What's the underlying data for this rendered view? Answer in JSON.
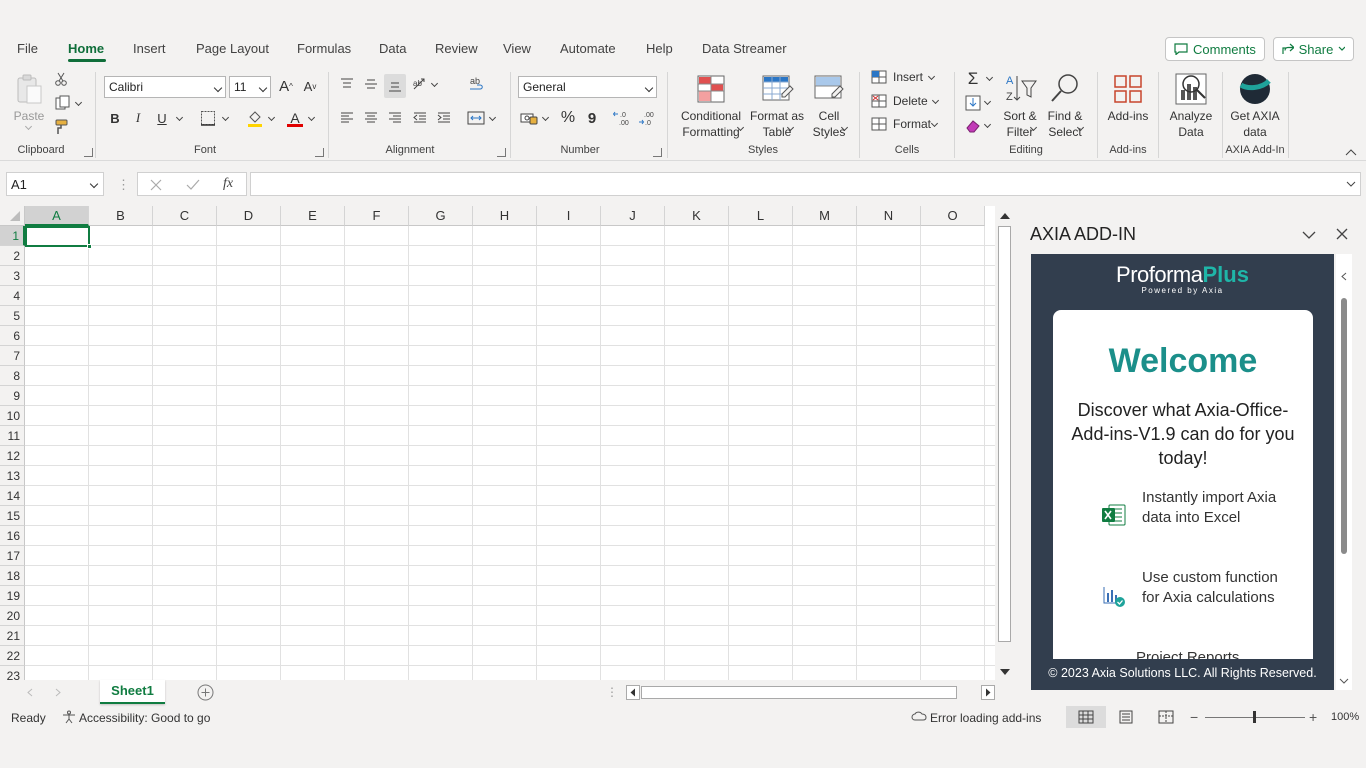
{
  "tabs": [
    "File",
    "Home",
    "Insert",
    "Page Layout",
    "Formulas",
    "Data",
    "Review",
    "View",
    "Automate",
    "Help",
    "Data Streamer"
  ],
  "header_buttons": {
    "comments": "Comments",
    "share": "Share"
  },
  "ribbon": {
    "clipboard": {
      "paste": "Paste",
      "label": "Clipboard"
    },
    "font": {
      "family": "Calibri",
      "size": "11",
      "bold": "B",
      "italic": "I",
      "underline": "U",
      "grow": "A",
      "shrink": "A",
      "color_letter": "A",
      "label": "Font"
    },
    "alignment": {
      "label": "Alignment"
    },
    "number": {
      "format": "General",
      "percent": "%",
      "comma": "9",
      "label": "Number"
    },
    "styles": {
      "conditional_1": "Conditional",
      "conditional_2": "Formatting",
      "format_table_1": "Format as",
      "format_table_2": "Table",
      "cell_styles_1": "Cell",
      "cell_styles_2": "Styles",
      "label": "Styles"
    },
    "cells": {
      "insert": "Insert",
      "delete": "Delete",
      "format": "Format",
      "label": "Cells"
    },
    "editing": {
      "sort_1": "Sort &",
      "sort_2": "Filter",
      "find_1": "Find &",
      "find_2": "Select",
      "label": "Editing"
    },
    "addins": {
      "addins": "Add-ins",
      "label": "Add-ins"
    },
    "analyze": {
      "line1": "Analyze",
      "line2": "Data"
    },
    "axia": {
      "line1": "Get AXIA",
      "line2": "data",
      "label": "AXIA Add-In"
    }
  },
  "formula_bar": {
    "name_box": "A1",
    "fx": "fx",
    "formula": ""
  },
  "grid": {
    "columns": [
      "A",
      "B",
      "C",
      "D",
      "E",
      "F",
      "G",
      "H",
      "I",
      "J",
      "K",
      "L",
      "M",
      "N",
      "O"
    ],
    "rows": [
      "1",
      "2",
      "3",
      "4",
      "5",
      "6",
      "7",
      "8",
      "9",
      "10",
      "11",
      "12",
      "13",
      "14",
      "15",
      "16",
      "17",
      "18",
      "19",
      "20",
      "21",
      "22",
      "23"
    ],
    "selected_cell": "A1"
  },
  "sheets": {
    "active": "Sheet1"
  },
  "status": {
    "ready": "Ready",
    "accessibility": "Accessibility: Good to go",
    "error": "Error loading add-ins",
    "zoom": "100%"
  },
  "pane": {
    "title": "AXIA ADD-IN",
    "logo_main_1": "Proforma",
    "logo_main_2": "Plus",
    "logo_sub": "Powered by Axia",
    "welcome": "Welcome",
    "discover": "Discover what Axia-Office-Add-ins-V1.9 can do for you today!",
    "features": [
      {
        "icon": "excel-icon",
        "text": "Instantly import Axia data into Excel"
      },
      {
        "icon": "chart-check-icon",
        "text": "Use custom function for Axia calculations"
      },
      {
        "icon": "reports-icon",
        "text": "Project Reports"
      }
    ],
    "footer": "© 2023 Axia Solutions LLC. All Rights Reserved."
  },
  "colors": {
    "excel_green": "#107c41",
    "tab_green": "#0f6e3a",
    "pane_dark": "#323e4e",
    "welcome_teal": "#1b8f8a"
  }
}
